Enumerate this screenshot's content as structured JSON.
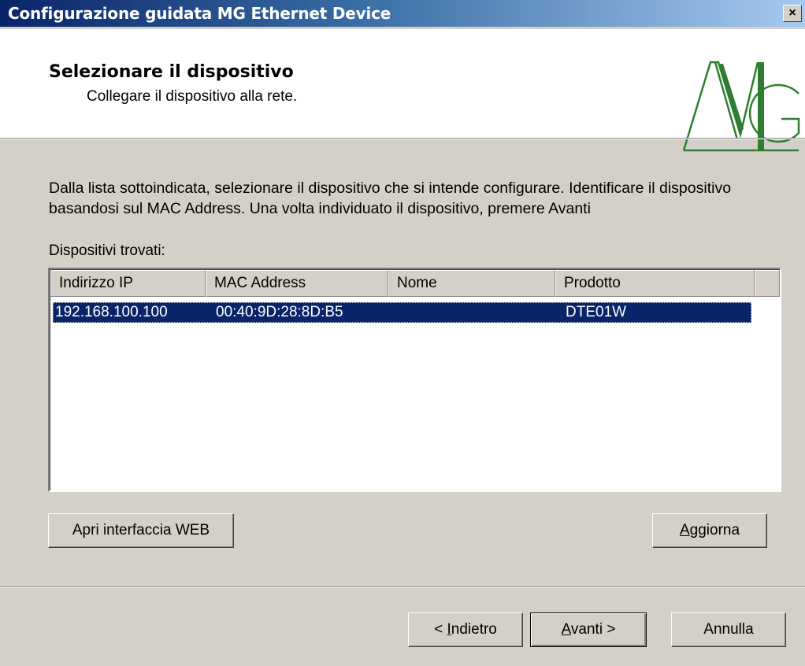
{
  "window": {
    "title": "Configurazione guidata MG Ethernet Device",
    "close_label": "×"
  },
  "header": {
    "title": "Selezionare il dispositivo",
    "subtitle": "Collegare il dispositivo alla rete.",
    "logo_text": "MG"
  },
  "content": {
    "description": "Dalla lista sottoindicata, selezionare il dispositivo che si intende configurare.  Identificare il dispositivo basandosi sul MAC Address.  Una volta individuato il dispositivo, premere Avanti",
    "list_label": "Dispositivi trovati:"
  },
  "device_list": {
    "columns": [
      "Indirizzo IP",
      "MAC Address",
      "Nome",
      "Prodotto"
    ],
    "rows": [
      {
        "ip": "192.168.100.100",
        "mac": "00:40:9D:28:8D:B5",
        "name": "",
        "product": "DTE01W",
        "selected": true
      }
    ]
  },
  "buttons": {
    "open_web": "Apri interfaccia WEB",
    "refresh_pre": "",
    "refresh_accel": "A",
    "refresh_post": "ggiorna",
    "back_pre": "< ",
    "back_accel": "I",
    "back_post": "ndietro",
    "next_pre": "",
    "next_accel": "A",
    "next_post": "vanti >",
    "cancel": "Annulla"
  },
  "colors": {
    "selection": "#0a246a",
    "face": "#d4d0c8",
    "logo_green": "#2e7d32"
  }
}
